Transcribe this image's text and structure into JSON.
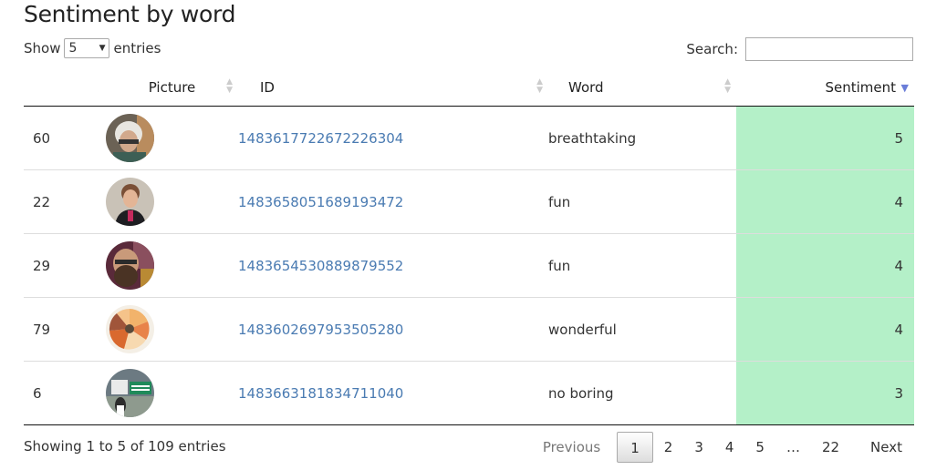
{
  "title": "Sentiment by word",
  "length": {
    "show_label": "Show",
    "value": "5",
    "entries_label": "entries"
  },
  "search": {
    "label": "Search:",
    "value": ""
  },
  "columns": {
    "picture": "Picture",
    "id": "ID",
    "word": "Word",
    "sentiment": "Sentiment"
  },
  "rows": [
    {
      "row": "60",
      "id": "1483617722672226304",
      "word": "breathtaking",
      "sentiment": "5",
      "avatar": "avatar-grey-hair"
    },
    {
      "row": "22",
      "id": "1483658051689193472",
      "word": "fun",
      "sentiment": "4",
      "avatar": "avatar-person"
    },
    {
      "row": "29",
      "id": "1483654530889879552",
      "word": "fun",
      "sentiment": "4",
      "avatar": "avatar-bearded"
    },
    {
      "row": "79",
      "id": "1483602697953505280",
      "word": "wonderful",
      "sentiment": "4",
      "avatar": "avatar-pie-chart"
    },
    {
      "row": "6",
      "id": "1483663181834711040",
      "word": "no boring",
      "sentiment": "3",
      "avatar": "avatar-sign"
    }
  ],
  "info": "Showing 1 to 5 of 109 entries",
  "pager": {
    "previous": "Previous",
    "pages": [
      "1",
      "2",
      "3",
      "4",
      "5"
    ],
    "ellipsis": "…",
    "last": "22",
    "next": "Next"
  },
  "colors": {
    "sentiment_bg": "#b4f0c8",
    "link": "#4a7bb2",
    "sort_active": "#6a7dd8"
  }
}
